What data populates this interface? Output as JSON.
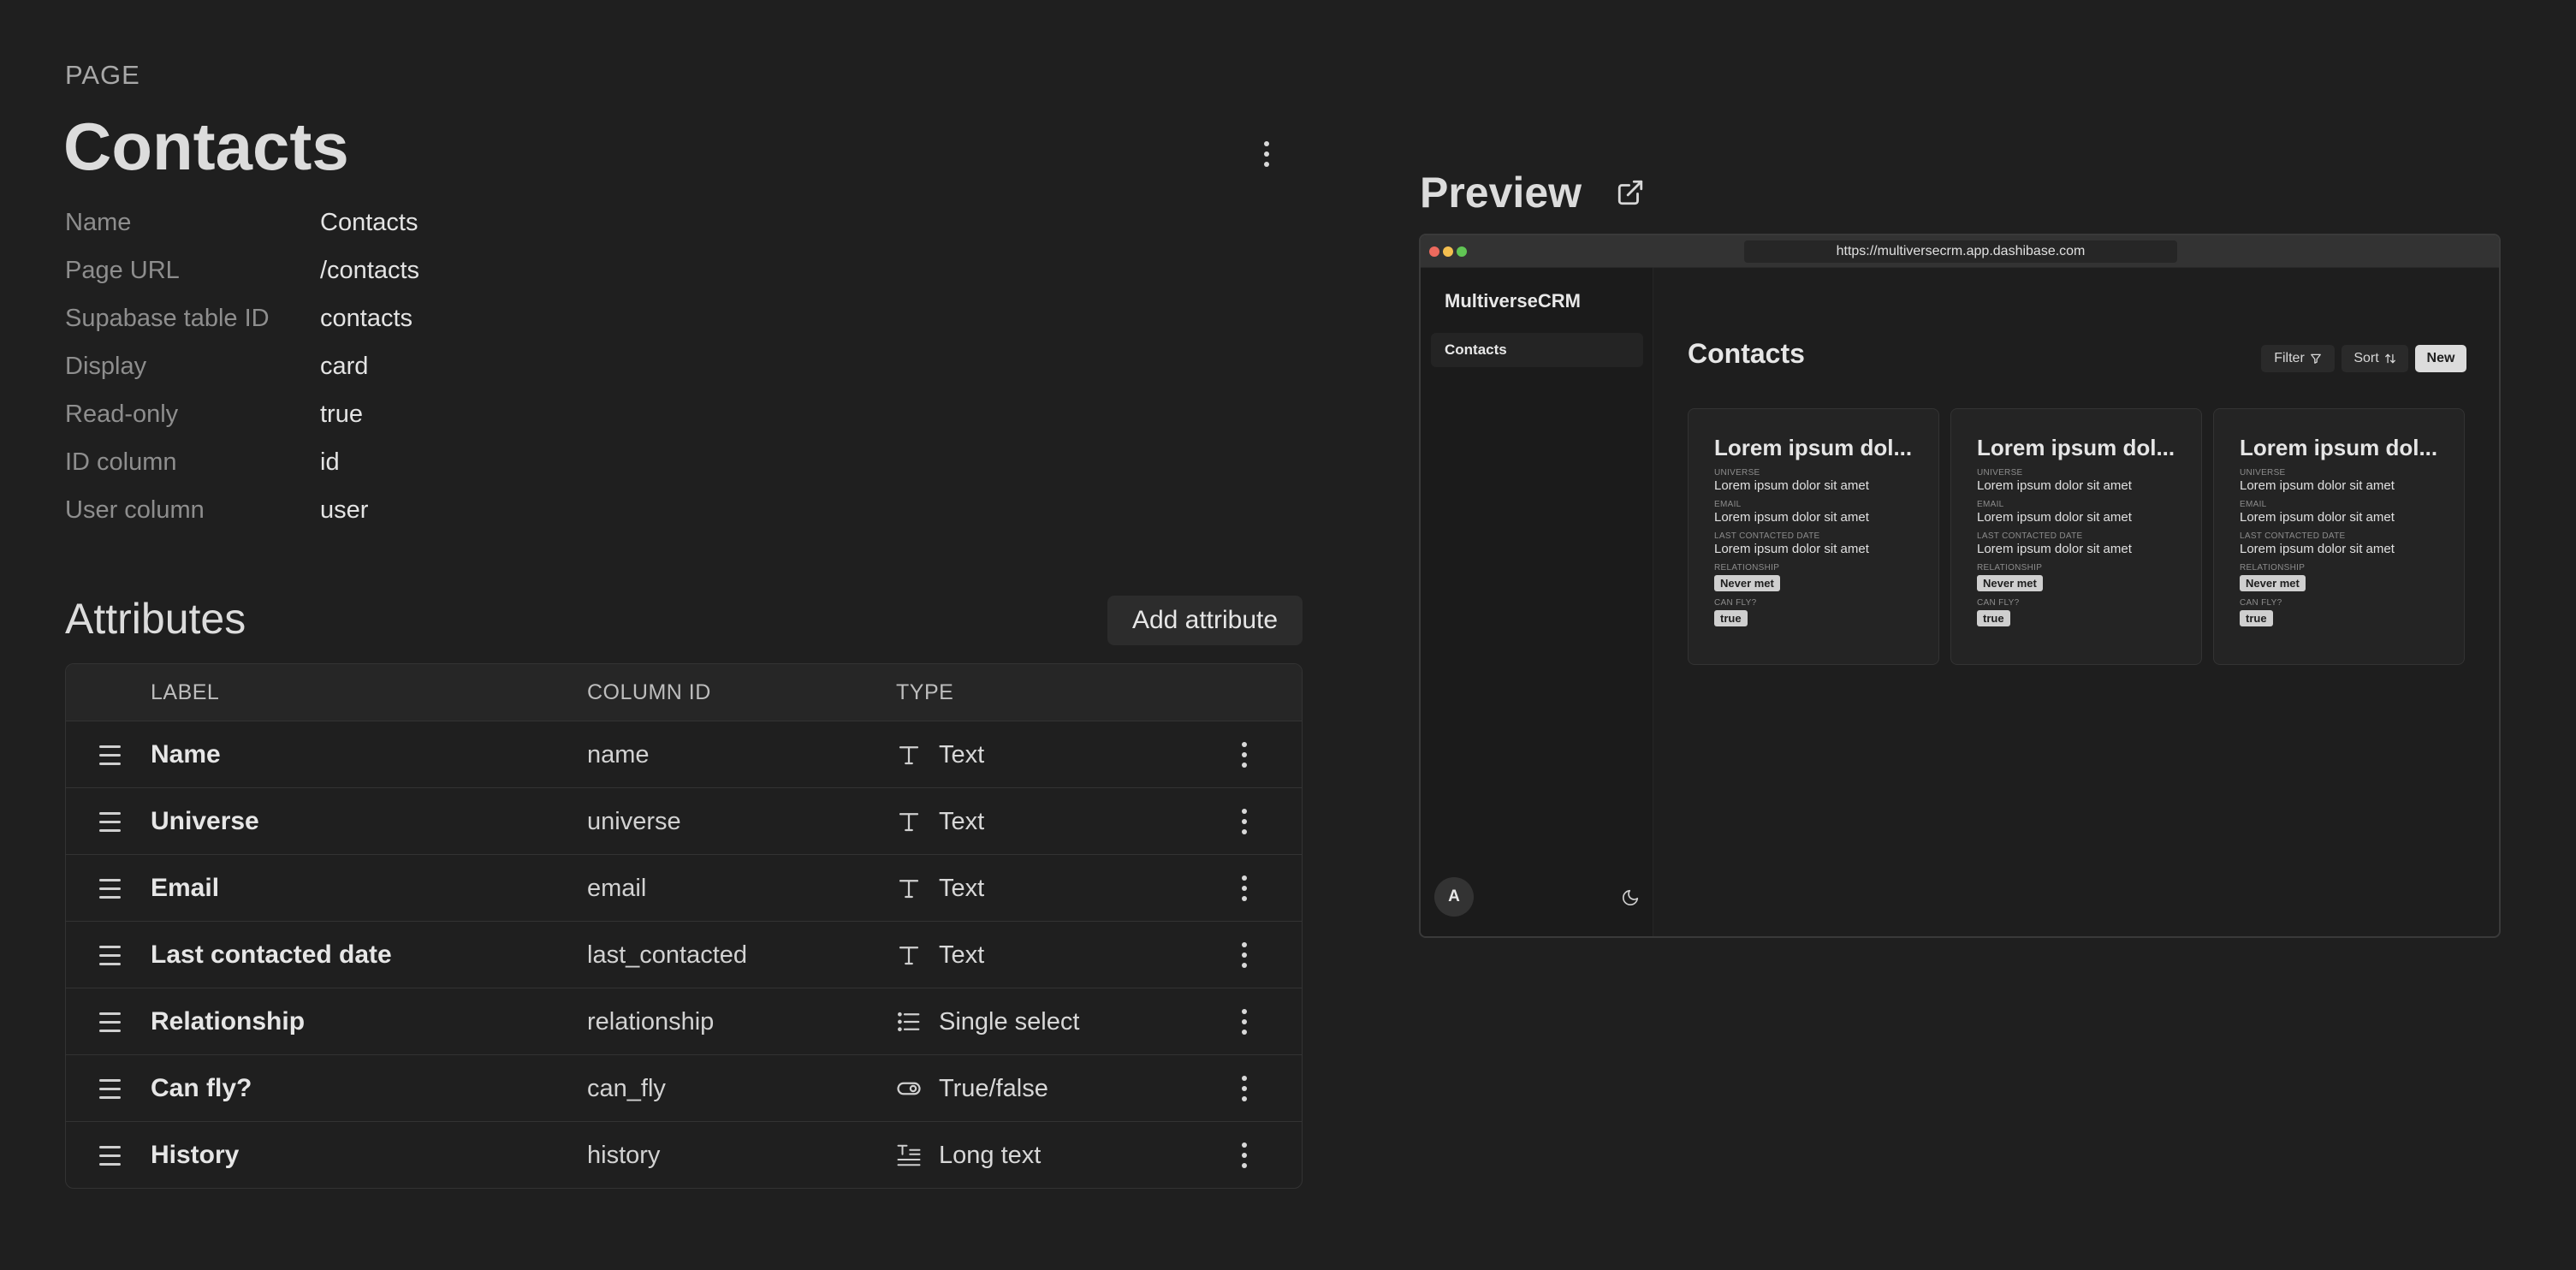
{
  "page": {
    "eyebrow": "PAGE",
    "title": "Contacts",
    "properties": [
      {
        "key": "Name",
        "value": "Contacts"
      },
      {
        "key": "Page URL",
        "value": "/contacts"
      },
      {
        "key": "Supabase table ID",
        "value": "contacts"
      },
      {
        "key": "Display",
        "value": "card"
      },
      {
        "key": "Read-only",
        "value": "true"
      },
      {
        "key": "ID column",
        "value": "id"
      },
      {
        "key": "User column",
        "value": "user"
      }
    ]
  },
  "attributes": {
    "heading": "Attributes",
    "add_label": "Add attribute",
    "columns": {
      "label": "LABEL",
      "column_id": "COLUMN ID",
      "type": "TYPE"
    },
    "rows": [
      {
        "label": "Name",
        "column_id": "name",
        "type": "Text",
        "icon": "text-type-icon"
      },
      {
        "label": "Universe",
        "column_id": "universe",
        "type": "Text",
        "icon": "text-type-icon"
      },
      {
        "label": "Email",
        "column_id": "email",
        "type": "Text",
        "icon": "text-type-icon"
      },
      {
        "label": "Last contacted date",
        "column_id": "last_contacted",
        "type": "Text",
        "icon": "text-type-icon"
      },
      {
        "label": "Relationship",
        "column_id": "relationship",
        "type": "Single select",
        "icon": "list-icon"
      },
      {
        "label": "Can fly?",
        "column_id": "can_fly",
        "type": "True/false",
        "icon": "toggle-icon"
      },
      {
        "label": "History",
        "column_id": "history",
        "type": "Long text",
        "icon": "long-text-icon"
      }
    ]
  },
  "preview": {
    "heading": "Preview",
    "url": "https://multiversecrm.app.dashibase.com",
    "app_name": "MultiverseCRM",
    "nav_item": "Contacts",
    "avatar_letter": "A",
    "page_title": "Contacts",
    "filter_label": "Filter",
    "sort_label": "Sort",
    "new_label": "New",
    "cards": [
      {
        "title": "Lorem ipsum dol...",
        "fields": [
          {
            "label": "UNIVERSE",
            "value": "Lorem ipsum dolor sit amet"
          },
          {
            "label": "EMAIL",
            "value": "Lorem ipsum dolor sit amet"
          },
          {
            "label": "LAST CONTACTED DATE",
            "value": "Lorem ipsum dolor sit amet"
          }
        ],
        "rel_label": "RELATIONSHIP",
        "rel_value": "Never met",
        "fly_label": "CAN FLY?",
        "fly_value": "true"
      },
      {
        "title": "Lorem ipsum dol...",
        "fields": [
          {
            "label": "UNIVERSE",
            "value": "Lorem ipsum dolor sit amet"
          },
          {
            "label": "EMAIL",
            "value": "Lorem ipsum dolor sit amet"
          },
          {
            "label": "LAST CONTACTED DATE",
            "value": "Lorem ipsum dolor sit amet"
          }
        ],
        "rel_label": "RELATIONSHIP",
        "rel_value": "Never met",
        "fly_label": "CAN FLY?",
        "fly_value": "true"
      },
      {
        "title": "Lorem ipsum dol...",
        "fields": [
          {
            "label": "UNIVERSE",
            "value": "Lorem ipsum dolor sit amet"
          },
          {
            "label": "EMAIL",
            "value": "Lorem ipsum dolor sit amet"
          },
          {
            "label": "LAST CONTACTED DATE",
            "value": "Lorem ipsum dolor sit amet"
          }
        ],
        "rel_label": "RELATIONSHIP",
        "rel_value": "Never met",
        "fly_label": "CAN FLY?",
        "fly_value": "true"
      }
    ]
  },
  "colors": {
    "background": "#1f1f1f",
    "traffic_red": "#ed6a5e",
    "traffic_yellow": "#f4bf4f",
    "traffic_green": "#61c554"
  }
}
